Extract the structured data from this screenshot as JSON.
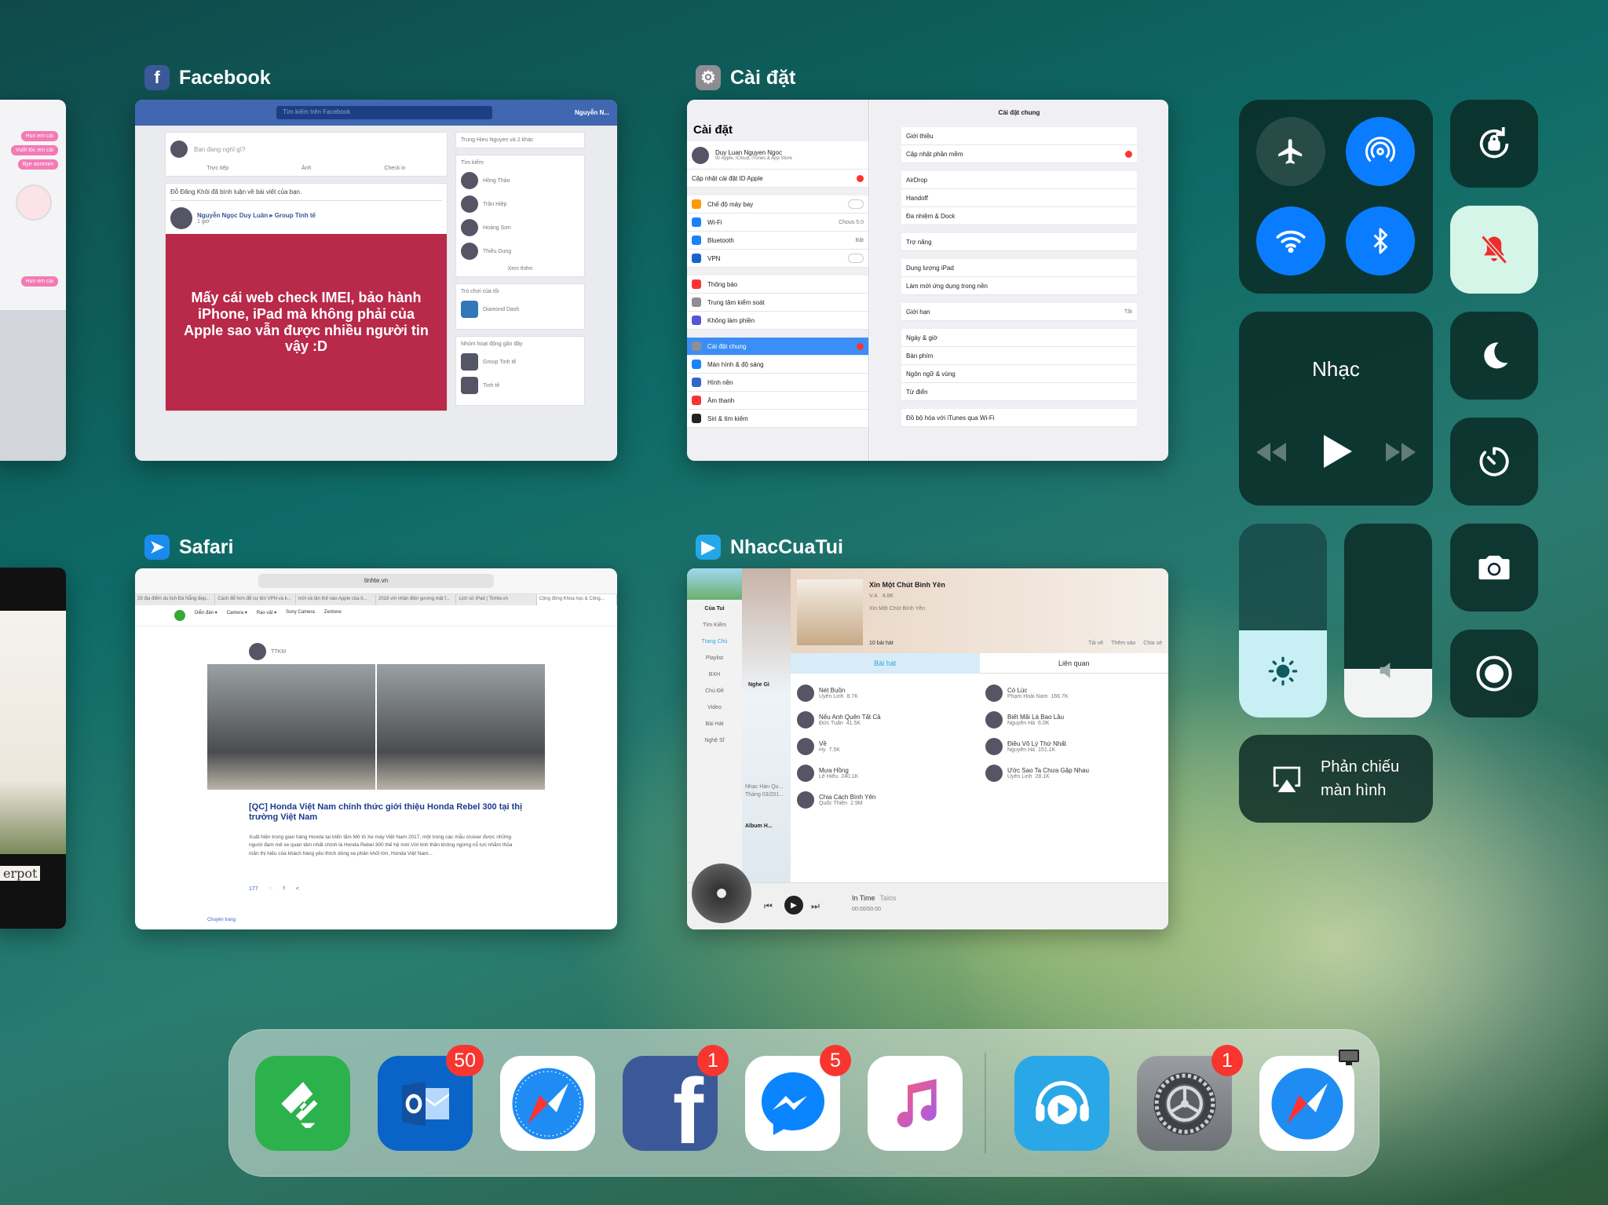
{
  "switcher": {
    "facebook": {
      "label": "Facebook",
      "search_placeholder": "Tìm kiếm trên Facebook",
      "user": "Nguyễn N...",
      "compose_placeholder": "Bạn đang nghĩ gì?",
      "compose_actions": [
        "Trực tiếp",
        "Ảnh",
        "Check in"
      ],
      "notification": "Đỗ Đăng Khôi đã bình luận về bài viết của bạn.",
      "post_author": "Nguyễn Ngọc Duy Luân ▸ Group Tinh tế",
      "post_time": "1 giờ · ",
      "post_text": "Mấy cái web check IMEI, bảo hành iPhone, iPad mà không phải của Apple sao vẫn được nhiều người tin vậy :D",
      "side_header": "Trung Hieu Nguyen và 2 khác",
      "side_search": "Tìm kiếm",
      "friends": [
        "Hồng Thảo",
        "Trần Hiệp",
        "Hoàng Sơn",
        "Thiều Dung"
      ],
      "see_more": "Xem thêm",
      "games_header": "Trò chơi của tôi",
      "game": "Diamond Dash",
      "groups_header": "Nhóm hoạt động gần đây",
      "groups": [
        "Group Tinh tế",
        "Tinh tế"
      ]
    },
    "settings": {
      "label": "Cài đặt",
      "left_title": "Cài đặt",
      "profile_name": "Duy Luan Nguyen Ngoc",
      "profile_sub": "ID Apple, iCloud, iTunes & App Store",
      "update_apple_id": "Cập nhật cài đặt ID Apple",
      "left_items": [
        "Chế độ máy bay",
        "Wi-Fi",
        "Bluetooth",
        "VPN",
        "Thông báo",
        "Trung tâm kiểm soát",
        "Không làm phiền",
        "Cài đặt chung",
        "Màn hình & độ sáng",
        "Hình nền",
        "Âm thanh",
        "Siri & tìm kiếm"
      ],
      "wifi_value": "Chous 5.0",
      "bluetooth_value": "Bật",
      "right_title": "Cài đặt chung",
      "right_items": [
        "Giới thiệu",
        "Cập nhật phần mềm",
        "AirDrop",
        "Handoff",
        "Đa nhiệm & Dock",
        "Trợ năng",
        "Dung lượng iPad",
        "Làm mới ứng dụng trong nền",
        "Giới hạn",
        "Ngày & giờ",
        "Bàn phím",
        "Ngôn ngữ & vùng",
        "Từ điển",
        "Đồ bộ hóa với iTunes qua Wi-Fi"
      ],
      "restrictions_value": "Tắt"
    },
    "safari": {
      "label": "Safari",
      "url": "tinhte.vn",
      "tabs": [
        "29 địa điểm du lịch Đà Nẵng đẹp...",
        "Cách để hơn để cự tên VPN và k...",
        "mới và tận thế nào Apple của tì...",
        "2018 với nhận điện gương mặt f...",
        "Lịch sử iPad | Tinhte.vn",
        "Cộng đồng Khoa học & Công..."
      ],
      "nav": [
        "Diễn đàn ▾",
        "Camera ▾",
        "Rao vặt ▾",
        "Sony Camera",
        "Zentone"
      ],
      "author": "TTKM",
      "article_title": "[QC] Honda Việt Nam chính thức giới thiệu Honda Rebel 300 tại thị trường Việt Nam",
      "article_body": "Xuất hiện trong gian hàng Honda tại triển lãm Mô tô Xe máy Việt Nam 2017, một trong các mẫu cruiser được những người đam mê xe quan tâm nhất chính là Honda Rebel 300 thế hệ mới.Với tinh thần không ngừng nỗ lực nhằm thỏa mãn thị hiếu của khách hàng yêu thích dòng xe phân khối lớn, Honda Việt Nam...",
      "views": "177",
      "footer": "Chuyên trang"
    },
    "nhaccuatui": {
      "label": "NhacCuaTui",
      "nav": [
        "Của Tui",
        "Tìm Kiếm",
        "Trang Chủ",
        "Playlist",
        "BXH",
        "Chủ Đề",
        "Video",
        "Bài Hát",
        "Nghệ Sĩ"
      ],
      "album_title": "Xin Một Chút Bình Yên",
      "album_artist": "V.A",
      "album_plays": "4.8K",
      "album_sub": "Xin Một Chút Bình Yên",
      "song_count": "10 bài hát",
      "actions": [
        "Tải về",
        "Thêm vào",
        "Chia sẻ"
      ],
      "tabs": [
        "Bài hát",
        "Liên quan"
      ],
      "songs_left": [
        {
          "title": "Nét Buồn",
          "artist": "Uyên Linh",
          "plays": "8.7K"
        },
        {
          "title": "Nếu Anh Quên Tất Cả",
          "artist": "Đức Tuấn",
          "plays": "41.5K"
        },
        {
          "title": "Về",
          "artist": "Hy",
          "plays": "7.5K"
        },
        {
          "title": "Mưa Hồng",
          "artist": "Lê Hiếu",
          "plays": "240.1K"
        },
        {
          "title": "Chia Cách Bình Yên",
          "artist": "Quốc Thiên",
          "plays": "2.9M"
        }
      ],
      "songs_right": [
        {
          "title": "Có Lúc",
          "artist": "Phạm Hoài Nam",
          "plays": "166.7K"
        },
        {
          "title": "Biết Mãi Là Bao Lâu",
          "artist": "Nguyên Hà",
          "plays": "6.0K"
        },
        {
          "title": "Điều Vô Lý Thứ Nhất",
          "artist": "Nguyên Hà",
          "plays": "151.1K"
        },
        {
          "title": "Ước Sao Ta Chưa Gặp Nhau",
          "artist": "Uyên Linh",
          "plays": "28.1K"
        }
      ],
      "now_playing": "In Time",
      "now_artist": "Talos",
      "time": "00:00/00:00",
      "promo": [
        "Nghe Gì",
        "Nhạc Hàn Qu...",
        "Tháng 03/201...",
        "Album H..."
      ]
    },
    "left_partial": {
      "messages": [
        "Hun em cái",
        "Vuốt tóc em cái",
        "Bye anmmm",
        "Hun em cái",
        "Hun em cái"
      ],
      "partial_text": "erpot"
    }
  },
  "control_center": {
    "music_title": "Nhạc",
    "screen_mirroring": "Phản chiếu\nmàn hình",
    "brightness": 0.45,
    "volume": 0.25,
    "airplane_mode": false,
    "airdrop": true,
    "wifi": true,
    "bluetooth": true,
    "silent": true,
    "accent": "#0a7cff"
  },
  "dock": {
    "apps": [
      {
        "name": "Feedly",
        "badge": ""
      },
      {
        "name": "Outlook",
        "badge": "50"
      },
      {
        "name": "Safari",
        "badge": ""
      },
      {
        "name": "Facebook",
        "badge": "1"
      },
      {
        "name": "Messenger",
        "badge": "5"
      },
      {
        "name": "Music",
        "badge": ""
      },
      {
        "name": "NhacCuaTui",
        "badge": ""
      },
      {
        "name": "Settings",
        "badge": "1"
      },
      {
        "name": "Safari",
        "badge": ""
      }
    ]
  }
}
